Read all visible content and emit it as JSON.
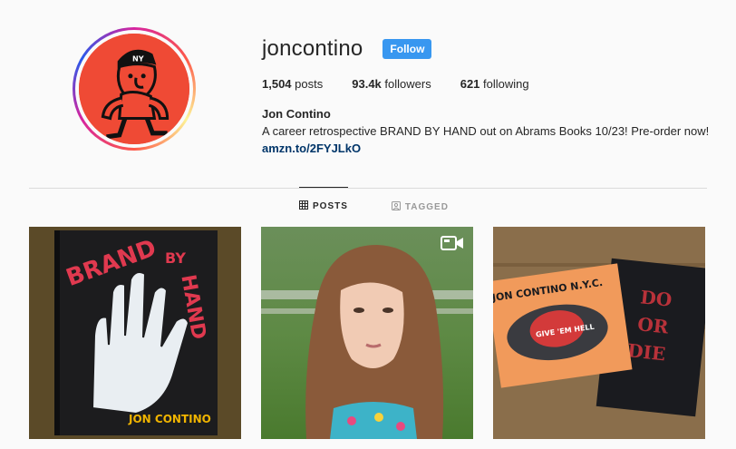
{
  "profile": {
    "username": "joncontino",
    "follow_label": "Follow",
    "full_name": "Jon Contino",
    "bio": "A career retrospective BRAND BY HAND out on Abrams Books 10/23! Pre-order now!",
    "link": "amzn.to/2FYJLkO"
  },
  "stats": {
    "posts_count": "1,504",
    "posts_label": "posts",
    "followers_count": "93.4k",
    "followers_label": "followers",
    "following_count": "621",
    "following_label": "following"
  },
  "tabs": [
    {
      "label": "POSTS",
      "icon": "grid-icon",
      "active": true
    },
    {
      "label": "TAGGED",
      "icon": "tag-icon",
      "active": false
    }
  ],
  "posts": [
    {
      "alt": "BRAND BY HAND book cover",
      "cover_lines": [
        "BRAND",
        "BY",
        "HAND",
        "JON CONTINO"
      ],
      "type": "image"
    },
    {
      "alt": "child portrait",
      "type": "video"
    },
    {
      "alt": "prints",
      "print_lines": [
        "JON CONTINO N.Y.C.",
        "GIVE 'EM HELL",
        "DO",
        "OR",
        "DIE"
      ],
      "type": "image"
    }
  ],
  "colors": {
    "accent": "#3897f0",
    "link": "#003569",
    "avatar_bg": "#ef4a35"
  }
}
